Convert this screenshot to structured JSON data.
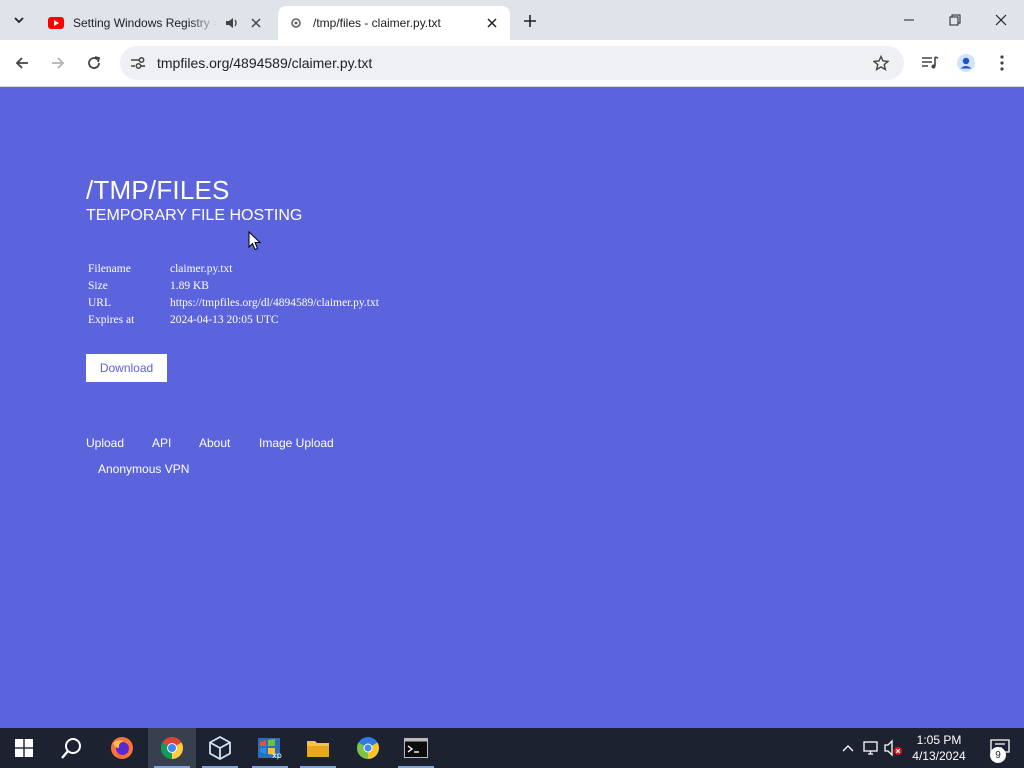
{
  "browser": {
    "tabs": [
      {
        "title": "Setting Windows Registry =",
        "active": false,
        "audio": true
      },
      {
        "title": "/tmp/files - claimer.py.txt",
        "active": true,
        "audio": false
      }
    ],
    "address": "tmpfiles.org/4894589/claimer.py.txt"
  },
  "page": {
    "title": "/TMP/FILES",
    "subtitle": "TEMPORARY FILE HOSTING",
    "file_info": {
      "rows": [
        {
          "label": "Filename",
          "value": "claimer.py.txt"
        },
        {
          "label": "Size",
          "value": "1.89 KB"
        },
        {
          "label": "URL",
          "value": "https://tmpfiles.org/dl/4894589/claimer.py.txt"
        },
        {
          "label": "Expires at",
          "value": "2024-04-13 20:05 UTC"
        }
      ]
    },
    "download_label": "Download",
    "footer_links": [
      "Upload",
      "API",
      "About",
      "Image Upload",
      "Anonymous VPN"
    ],
    "colors": {
      "background": "#5b63dd",
      "text": "#ffffff"
    }
  },
  "taskbar": {
    "apps": [
      "start-icon",
      "search-icon",
      "firefox-icon",
      "chrome-icon",
      "virtualbox-icon",
      "windows-xp-icon",
      "file-explorer-icon",
      "chromium-icon",
      "terminal-icon"
    ],
    "time": "1:05 PM",
    "date": "4/13/2024",
    "notification_count": "9"
  }
}
